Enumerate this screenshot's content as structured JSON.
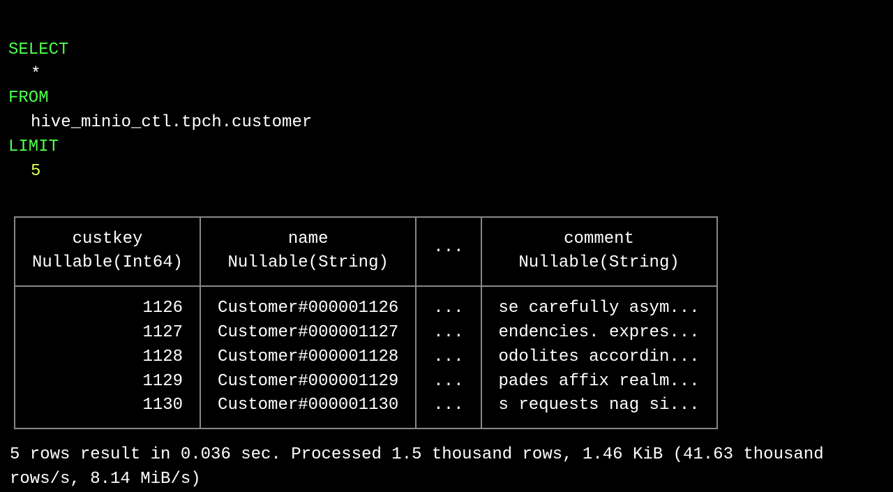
{
  "sql": {
    "select_kw": "SELECT",
    "select_cols": "*",
    "from_kw": "FROM",
    "table_ref": "hive_minio_ctl.tpch.customer",
    "limit_kw": "LIMIT",
    "limit_n": "5"
  },
  "result": {
    "columns": [
      {
        "name": "custkey",
        "type": "Nullable(Int64)"
      },
      {
        "name": "name",
        "type": "Nullable(String)"
      },
      {
        "name": "···",
        "type": ""
      },
      {
        "name": "comment",
        "type": "Nullable(String)"
      }
    ],
    "rows": [
      {
        "custkey": "1126",
        "name": "Customer#000001126",
        "ellipsis": "...",
        "comment": "se carefully asym..."
      },
      {
        "custkey": "1127",
        "name": "Customer#000001127",
        "ellipsis": "...",
        "comment": "endencies. expres..."
      },
      {
        "custkey": "1128",
        "name": "Customer#000001128",
        "ellipsis": "...",
        "comment": "odolites accordin..."
      },
      {
        "custkey": "1129",
        "name": "Customer#000001129",
        "ellipsis": "...",
        "comment": "pades affix realm..."
      },
      {
        "custkey": "1130",
        "name": "Customer#000001130",
        "ellipsis": "...",
        "comment": "s requests nag si..."
      }
    ]
  },
  "status": "5 rows result in 0.036 sec. Processed 1.5 thousand rows, 1.46 KiB (41.63 thousand rows/s, 8.14 MiB/s)"
}
